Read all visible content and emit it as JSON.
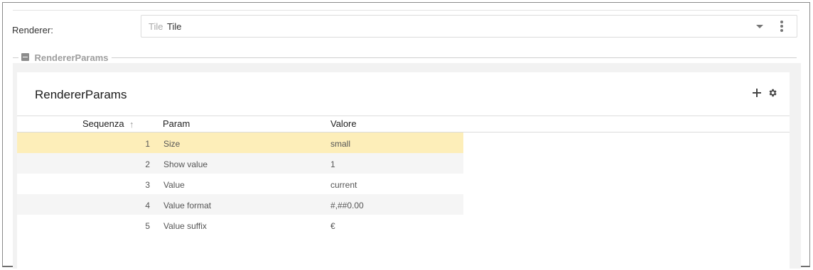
{
  "renderer": {
    "label": "Renderer:",
    "placeholder": "Tile",
    "value": "Tile"
  },
  "fieldset": {
    "legend": "RendererParams"
  },
  "card": {
    "title": "RendererParams",
    "add_icon": "plus-icon",
    "settings_icon": "gear-icon"
  },
  "table": {
    "columns": [
      "Sequenza",
      "Param",
      "Valore"
    ],
    "sort_icon": "↑",
    "rows": [
      {
        "seq": "1",
        "param": "Size",
        "value": "small"
      },
      {
        "seq": "2",
        "param": "Show value",
        "value": "1"
      },
      {
        "seq": "3",
        "param": "Value",
        "value": "current"
      },
      {
        "seq": "4",
        "param": "Value format",
        "value": "#,##0.00"
      },
      {
        "seq": "5",
        "param": "Value suffix",
        "value": "€"
      }
    ]
  },
  "colors": {
    "selected_row": "#fdeeb9",
    "alt_row": "#f5f5f5"
  }
}
